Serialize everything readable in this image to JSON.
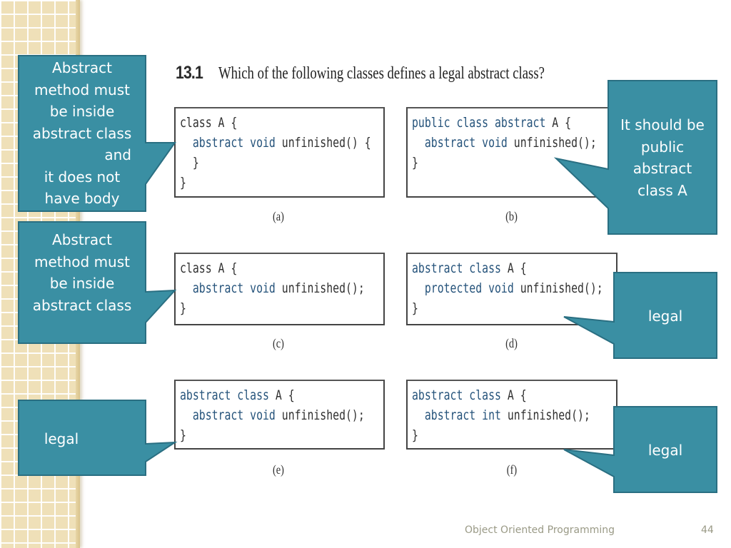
{
  "slide": {
    "question_number": "13.1",
    "question_text": "Which of the following classes defines a legal abstract class?",
    "footer_title": "Object Oriented Programming",
    "page_number": "44",
    "accent_color": "#3a8fa3",
    "callout_border_color": "#2a6f82"
  },
  "options": [
    {
      "label": "(a)",
      "code": [
        [
          {
            "t": "class A {",
            "k": false
          }
        ],
        [
          {
            "t": "  ",
            "k": false
          },
          {
            "t": "abstract void",
            "k": true
          },
          {
            "t": " unfinished() {",
            "k": false
          }
        ],
        [
          {
            "t": "  }",
            "k": false
          }
        ],
        [
          {
            "t": "}",
            "k": false
          }
        ]
      ]
    },
    {
      "label": "(b)",
      "code": [
        [
          {
            "t": "public class abstract",
            "k": true
          },
          {
            "t": " A {",
            "k": false
          }
        ],
        [
          {
            "t": "  ",
            "k": false
          },
          {
            "t": "abstract void",
            "k": true
          },
          {
            "t": " unfinished();",
            "k": false
          }
        ],
        [
          {
            "t": "}",
            "k": false
          }
        ]
      ]
    },
    {
      "label": "(c)",
      "code": [
        [
          {
            "t": "class A {",
            "k": false
          }
        ],
        [
          {
            "t": "  ",
            "k": false
          },
          {
            "t": "abstract void",
            "k": true
          },
          {
            "t": " unfinished();",
            "k": false
          }
        ],
        [
          {
            "t": "}",
            "k": false
          }
        ]
      ]
    },
    {
      "label": "(d)",
      "code": [
        [
          {
            "t": "abstract class",
            "k": true
          },
          {
            "t": " A {",
            "k": false
          }
        ],
        [
          {
            "t": "  ",
            "k": false
          },
          {
            "t": "protected void",
            "k": true
          },
          {
            "t": " unfinished();",
            "k": false
          }
        ],
        [
          {
            "t": "}",
            "k": false
          }
        ]
      ]
    },
    {
      "label": "(e)",
      "code": [
        [
          {
            "t": "abstract class",
            "k": true
          },
          {
            "t": " A {",
            "k": false
          }
        ],
        [
          {
            "t": "  ",
            "k": false
          },
          {
            "t": "abstract void",
            "k": true
          },
          {
            "t": " unfinished();",
            "k": false
          }
        ],
        [
          {
            "t": "}",
            "k": false
          }
        ]
      ]
    },
    {
      "label": "(f)",
      "code": [
        [
          {
            "t": "abstract class",
            "k": true
          },
          {
            "t": " A {",
            "k": false
          }
        ],
        [
          {
            "t": "  ",
            "k": false
          },
          {
            "t": "abstract int",
            "k": true
          },
          {
            "t": " unfinished();",
            "k": false
          }
        ],
        [
          {
            "t": "}",
            "k": false
          }
        ]
      ]
    }
  ],
  "callouts": {
    "a": [
      "Abstract",
      "method must",
      "be inside",
      "abstract class",
      "and",
      "it does not",
      "have body"
    ],
    "b": [
      "It should be",
      "public",
      "abstract",
      "class A"
    ],
    "c": [
      "Abstract",
      "method must",
      "be inside",
      "abstract class"
    ],
    "d": [
      "legal"
    ],
    "e": [
      "legal"
    ],
    "f": [
      "legal"
    ]
  }
}
